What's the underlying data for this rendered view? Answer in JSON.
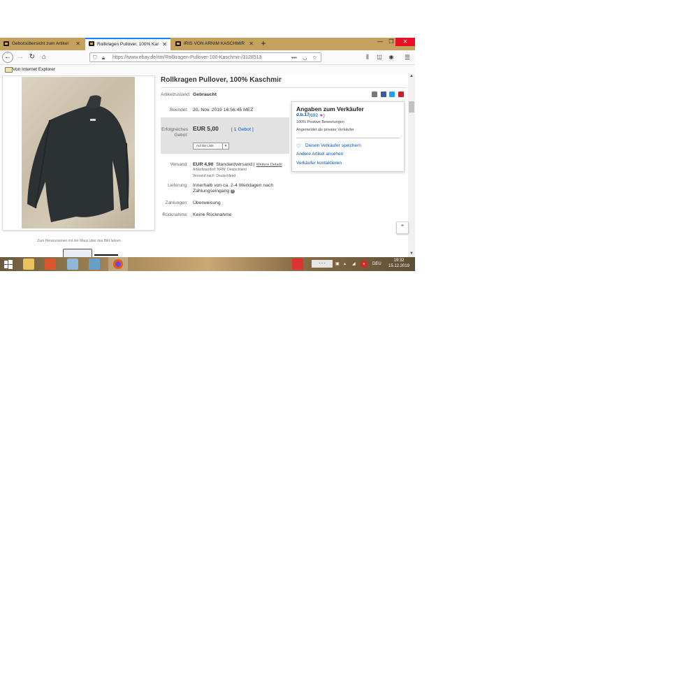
{
  "browser": {
    "tabs": [
      {
        "title": "Gebotsübersicht zum Artikel"
      },
      {
        "title": "Rollkragen Pullover, 100% Kasch"
      },
      {
        "title": "IRIS VON ARNIM KASCHMIR R"
      }
    ],
    "new_tab_label": "+",
    "window_controls": {
      "minimize": "—",
      "restore": "❐",
      "close": "✕"
    },
    "url_host": "https://www.ebay.de",
    "url_path": "/itm/Rollkragen-Pullover-100-Kaschmir-/3128513",
    "url_more": "•••",
    "bookmark": "Von Internet Explorer"
  },
  "item": {
    "title": "Rollkragen Pullover, 100% Kaschmir",
    "condition_label": "Artikelzustand:",
    "condition_value": "Gebraucht",
    "ended_label": "Beendet:",
    "ended_value": "20. Nov. 2019  16:56:45 MEZ",
    "bid_label": "Erfolgreiches Gebot:",
    "bid_value": "EUR 5,00",
    "bid_count": "[ 1 Gebot ]",
    "watch_button": "Auf die Liste",
    "shipping_label": "Versand:",
    "shipping_price": "EUR 4,90",
    "shipping_method": "Standardversand |",
    "shipping_details": "Weitere Details",
    "item_location": "Artikelstandort:  NRW, Deutschland",
    "ships_to": "Versand nach:  Deutschland",
    "delivery_label": "Lieferung:",
    "delivery_line1": "Innerhalb von ca. 2-4 Werktagen nach",
    "delivery_line2": "Zahlungseingang",
    "payment_label": "Zahlungen:",
    "payment_value": "Überweisung",
    "returns_label": "Rücknahme:",
    "returns_value": "Keine Rücknahme",
    "zoom_hint": "Zum Heranzoomen mit der Maus über das Bild fahren"
  },
  "seller": {
    "heading": "Angaben zum Verkäufer",
    "name": "d.b.17",
    "feedback": "(692 ",
    "feedback_star": "★",
    "feedback_close": ")",
    "positive": "100% Positive Bewertungen",
    "private": "Angemeldet als privater Verkäufer",
    "save_seller": "Diesen Verkäufer speichern",
    "other_items": "Andere Artikel ansehen",
    "contact": "Verkäufer kontaktieren"
  },
  "taskbar": {
    "language": "DEU",
    "time": "19:32",
    "date": "15.12.2019"
  },
  "colors": {
    "tabstrip": "#c4a15e",
    "link": "#0654ba",
    "close_red": "#e81123",
    "share_email": "#777777",
    "share_facebook": "#3b5998",
    "share_twitter": "#1da1f2",
    "share_pinterest": "#cb2027"
  }
}
